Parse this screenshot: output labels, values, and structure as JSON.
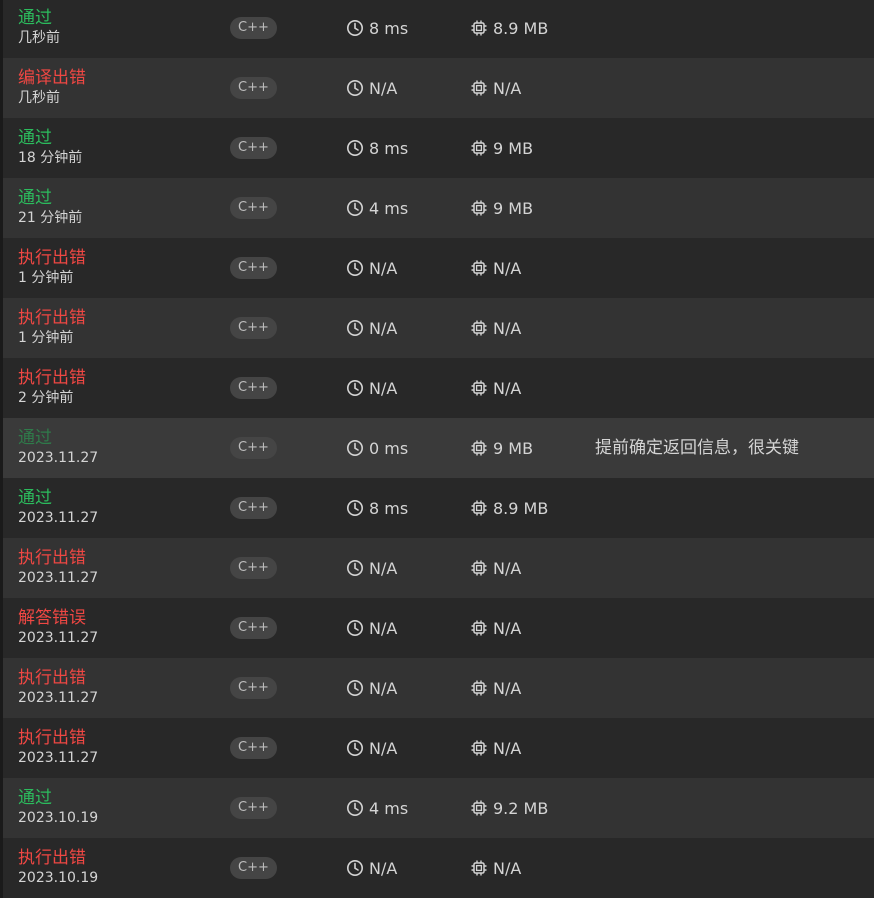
{
  "submissions": [
    {
      "status": "通过",
      "status_type": "ok",
      "time": "几秒前",
      "lang": "C++",
      "runtime": "8 ms",
      "memory": "8.9 MB",
      "note": ""
    },
    {
      "status": "编译出错",
      "status_type": "err",
      "time": "几秒前",
      "lang": "C++",
      "runtime": "N/A",
      "memory": "N/A",
      "note": ""
    },
    {
      "status": "通过",
      "status_type": "ok",
      "time": "18 分钟前",
      "lang": "C++",
      "runtime": "8 ms",
      "memory": "9 MB",
      "note": ""
    },
    {
      "status": "通过",
      "status_type": "ok",
      "time": "21 分钟前",
      "lang": "C++",
      "runtime": "4 ms",
      "memory": "9 MB",
      "note": ""
    },
    {
      "status": "执行出错",
      "status_type": "err",
      "time": "1 分钟前",
      "lang": "C++",
      "runtime": "N/A",
      "memory": "N/A",
      "note": ""
    },
    {
      "status": "执行出错",
      "status_type": "err",
      "time": "1 分钟前",
      "lang": "C++",
      "runtime": "N/A",
      "memory": "N/A",
      "note": ""
    },
    {
      "status": "执行出错",
      "status_type": "err",
      "time": "2 分钟前",
      "lang": "C++",
      "runtime": "N/A",
      "memory": "N/A",
      "note": ""
    },
    {
      "status": "通过",
      "status_type": "dim",
      "time": "2023.11.27",
      "lang": "C++",
      "runtime": "0 ms",
      "memory": "9 MB",
      "note": "提前确定返回信息，很关键"
    },
    {
      "status": "通过",
      "status_type": "ok",
      "time": "2023.11.27",
      "lang": "C++",
      "runtime": "8 ms",
      "memory": "8.9 MB",
      "note": ""
    },
    {
      "status": "执行出错",
      "status_type": "err",
      "time": "2023.11.27",
      "lang": "C++",
      "runtime": "N/A",
      "memory": "N/A",
      "note": ""
    },
    {
      "status": "解答错误",
      "status_type": "err",
      "time": "2023.11.27",
      "lang": "C++",
      "runtime": "N/A",
      "memory": "N/A",
      "note": ""
    },
    {
      "status": "执行出错",
      "status_type": "err",
      "time": "2023.11.27",
      "lang": "C++",
      "runtime": "N/A",
      "memory": "N/A",
      "note": ""
    },
    {
      "status": "执行出错",
      "status_type": "err",
      "time": "2023.11.27",
      "lang": "C++",
      "runtime": "N/A",
      "memory": "N/A",
      "note": ""
    },
    {
      "status": "通过",
      "status_type": "ok",
      "time": "2023.10.19",
      "lang": "C++",
      "runtime": "4 ms",
      "memory": "9.2 MB",
      "note": ""
    },
    {
      "status": "执行出错",
      "status_type": "err",
      "time": "2023.10.19",
      "lang": "C++",
      "runtime": "N/A",
      "memory": "N/A",
      "note": ""
    }
  ],
  "icons": {
    "runtime": "clock-icon",
    "memory": "cpu-icon"
  },
  "colors": {
    "accepted": "#2cbb5d",
    "error": "#ef4743",
    "accepted_dim": "#2f7a4a",
    "row": "#282828",
    "row_alt": "#333333",
    "row_hover": "#3a3a3a"
  }
}
